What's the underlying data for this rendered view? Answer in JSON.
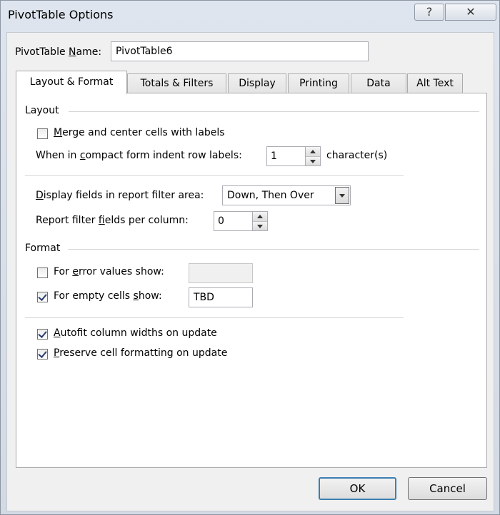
{
  "window": {
    "title": "PivotTable Options",
    "help_glyph": "?",
    "close_glyph": "✕"
  },
  "name_field": {
    "label_pre": "PivotTable ",
    "label_accel": "N",
    "label_post": "ame:",
    "value": "PivotTable6"
  },
  "tabs": [
    {
      "label": "Layout & Format",
      "active": true
    },
    {
      "label": "Totals & Filters",
      "active": false
    },
    {
      "label": "Display",
      "active": false
    },
    {
      "label": "Printing",
      "active": false
    },
    {
      "label": "Data",
      "active": false
    },
    {
      "label": "Alt Text",
      "active": false
    }
  ],
  "layout": {
    "section_title": "Layout",
    "merge_center": {
      "pre": "",
      "accel": "M",
      "post": "erge and center cells with labels",
      "checked": false
    },
    "indent": {
      "pre": "When in ",
      "accel": "c",
      "post": "ompact form indent row labels:",
      "value": "1",
      "suffix": "character(s)"
    },
    "display_fields": {
      "pre": "",
      "accel": "D",
      "post": "isplay fields in report filter area:",
      "value": "Down, Then Over"
    },
    "filter_fields": {
      "pre": "Report filter ",
      "accel": "f",
      "post": "ields per column:",
      "value": "0"
    }
  },
  "format": {
    "section_title": "Format",
    "error_values": {
      "pre": "For ",
      "accel": "e",
      "post": "rror values show:",
      "checked": false,
      "value": ""
    },
    "empty_cells": {
      "pre": "For empty cells ",
      "accel": "s",
      "post": "how:",
      "checked": true,
      "value": "TBD"
    },
    "autofit": {
      "pre": "",
      "accel": "A",
      "post": "utofit column widths on update",
      "checked": true
    },
    "preserve": {
      "pre": "",
      "accel": "P",
      "post": "reserve cell formatting on update",
      "checked": true
    }
  },
  "buttons": {
    "ok": "OK",
    "cancel": "Cancel"
  }
}
